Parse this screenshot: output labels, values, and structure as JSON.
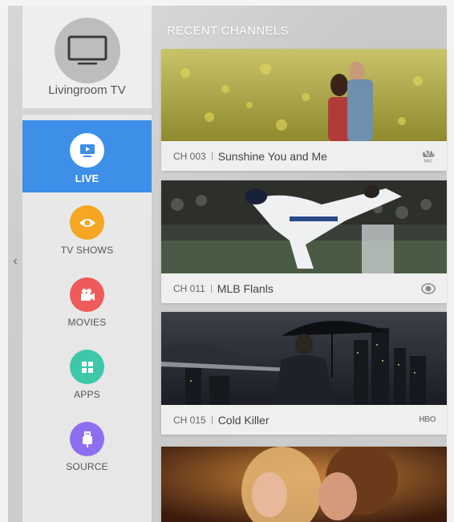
{
  "device": {
    "name": "Livingroom TV",
    "icon": "tv-icon"
  },
  "nav": [
    {
      "label": "LIVE",
      "icon": "live-tv-icon",
      "color": "#ffffff",
      "active": true
    },
    {
      "label": "TV SHOWS",
      "icon": "eye-icon",
      "color": "#f5a623",
      "active": false
    },
    {
      "label": "MOVIES",
      "icon": "movie-camera-icon",
      "color": "#ef5b5b",
      "active": false
    },
    {
      "label": "APPS",
      "icon": "apps-grid-icon",
      "color": "#3ec7a9",
      "active": false
    },
    {
      "label": "SOURCE",
      "icon": "usb-icon",
      "color": "#8e6ef0",
      "active": false
    }
  ],
  "section": {
    "title": "RECENT CHANNELS"
  },
  "channels": [
    {
      "number": "CH 003",
      "title": "Sunshine You and Me",
      "network_logo": "nbc-logo-icon"
    },
    {
      "number": "CH 011",
      "title": "MLB Flanls",
      "network_logo": "cbs-logo-icon"
    },
    {
      "number": "CH 015",
      "title": "Cold Killer",
      "network_logo": "hbo-logo-icon",
      "network_text": "HBO"
    },
    {
      "number": "",
      "title": "",
      "network_logo": ""
    }
  ],
  "colors": {
    "accent": "#3d8fe8",
    "sidebar_bg": "#ebebeb",
    "caption_bg": "#efefef"
  }
}
